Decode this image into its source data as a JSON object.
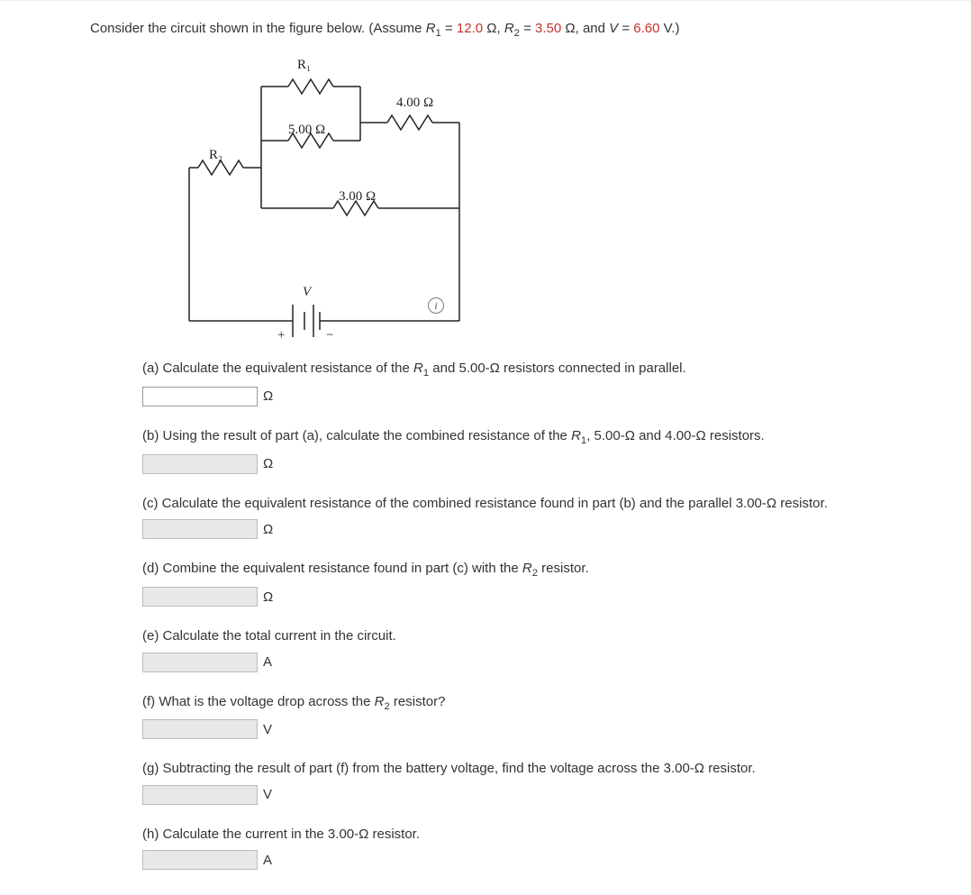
{
  "intro": {
    "prefix": "Consider the circuit shown in the figure below. (Assume ",
    "r1_sym": "R",
    "r1_sub": "1",
    "eq1": " = ",
    "r1_val": "12.0",
    "r1_unit": " Ω, ",
    "r2_sym": "R",
    "r2_sub": "2",
    "eq2": " = ",
    "r2_val": "3.50",
    "r2_unit": " Ω, and ",
    "v_sym": "V",
    "eq3": " = ",
    "v_val": "6.60",
    "v_unit": " V.)"
  },
  "circuit": {
    "R1_label": "R₁",
    "R2_label": "R₂",
    "R4_label": "4.00 Ω",
    "R5_label": "5.00 Ω",
    "R3_label": "3.00 Ω",
    "V_label": "V",
    "plus": "+",
    "minus": "−"
  },
  "info_icon": "i",
  "parts": {
    "a": {
      "text_pre": "(a) Calculate the equivalent resistance of the ",
      "sym": "R",
      "sub": "1",
      "text_post": " and 5.00-Ω resistors connected in parallel.",
      "unit": "Ω",
      "enabled": true
    },
    "b": {
      "text_pre": "(b) Using the result of part (a), calculate the combined resistance of the ",
      "sym": "R",
      "sub": "1",
      "text_post": ", 5.00-Ω and 4.00-Ω resistors.",
      "unit": "Ω",
      "enabled": false
    },
    "c": {
      "text": "(c) Calculate the equivalent resistance of the combined resistance found in part (b) and the parallel 3.00-Ω resistor.",
      "unit": "Ω",
      "enabled": false
    },
    "d": {
      "text_pre": "(d) Combine the equivalent resistance found in part (c) with the ",
      "sym": "R",
      "sub": "2",
      "text_post": " resistor.",
      "unit": "Ω",
      "enabled": false
    },
    "e": {
      "text": "(e) Calculate the total current in the circuit.",
      "unit": "A",
      "enabled": false
    },
    "f": {
      "text_pre": "(f) What is the voltage drop across the ",
      "sym": "R",
      "sub": "2",
      "text_post": " resistor?",
      "unit": "V",
      "enabled": false
    },
    "g": {
      "text": "(g) Subtracting the result of part (f) from the battery voltage, find the voltage across the 3.00-Ω resistor.",
      "unit": "V",
      "enabled": false
    },
    "h": {
      "text": "(h) Calculate the current in the 3.00-Ω resistor.",
      "unit": "A",
      "enabled": false
    }
  }
}
